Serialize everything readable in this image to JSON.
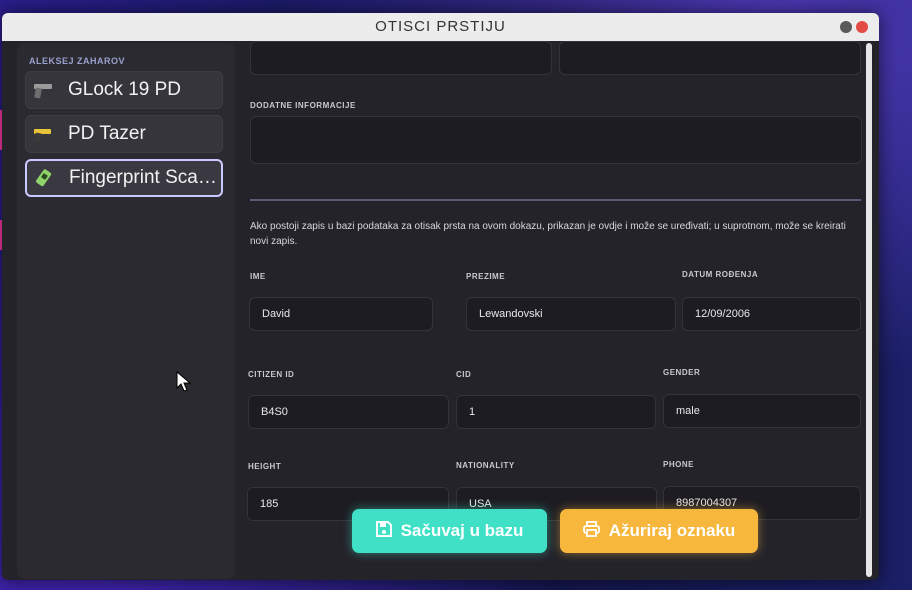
{
  "window": {
    "title": "OTISCI PRSTIJU",
    "colors": {
      "accent_save": "#3fe0c6",
      "accent_update": "#f6b73c",
      "close": "#e44b45"
    }
  },
  "sidebar": {
    "user": "ALEKSEJ ZAHAROV",
    "items": [
      {
        "label": "GLock 19 PD",
        "icon": "pistol-icon"
      },
      {
        "label": "PD Tazer",
        "icon": "taser-icon"
      },
      {
        "label": "Fingerprint Scanner",
        "icon": "fingerprint-scanner-icon",
        "active": true
      }
    ]
  },
  "form": {
    "additional_info_label": "DODATNE INFORMACIJE",
    "additional_info_value": "",
    "info_text": "Ako postoji zapis u bazi podataka za otisak prsta na ovom dokazu, prikazan je ovdje i može se uređivati; u suprotnom, može se kreirati novi zapis.",
    "fields": {
      "ime": {
        "label": "IME",
        "value": "David"
      },
      "prezime": {
        "label": "PREZIME",
        "value": "Lewandovski"
      },
      "datum": {
        "label": "DATUM ROĐENJA",
        "value": "12/09/2006"
      },
      "citizen_id": {
        "label": "CITIZEN ID",
        "value": "B4S0"
      },
      "cid": {
        "label": "CID",
        "value": "1"
      },
      "gender": {
        "label": "GENDER",
        "value": "male"
      },
      "height": {
        "label": "HEIGHT",
        "value": "185"
      },
      "nationality": {
        "label": "NATIONALITY",
        "value": "USA"
      },
      "phone": {
        "label": "PHONE",
        "value": "8987004307"
      }
    }
  },
  "actions": {
    "save_label": "Sačuvaj u bazu",
    "update_label": "Ažuriraj oznaku"
  }
}
